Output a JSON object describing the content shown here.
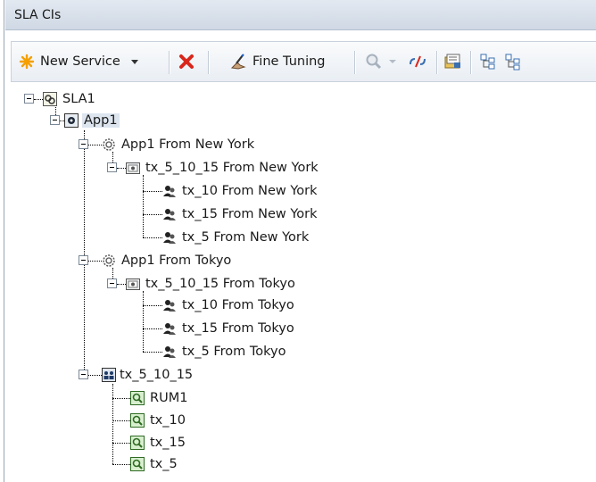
{
  "panel": {
    "title": "SLA CIs"
  },
  "toolbar": {
    "new_service_label": "New Service",
    "new_service_dropdown": "chevron-down",
    "fine_tuning_label": "Fine Tuning"
  },
  "tree": {
    "root": "SLA1",
    "app": "App1",
    "ny_group": "App1 From New York",
    "ny_tx": "tx_5_10_15 From New York",
    "ny_children": [
      "tx_10 From New York",
      "tx_15 From New York",
      "tx_5 From New York"
    ],
    "tokyo_group": "App1 From Tokyo",
    "tokyo_tx": "tx_5_10_15 From Tokyo",
    "tokyo_children": [
      "tx_10 From Tokyo",
      "tx_15 From Tokyo",
      "tx_5 From Tokyo"
    ],
    "tx_group": "tx_5_10_15",
    "tx_children": [
      "RUM1",
      "tx_10",
      "tx_15",
      "tx_5"
    ]
  },
  "icons": {
    "new_service": "asterisk-star-icon",
    "delete": "red-x-icon",
    "fine_tuning": "hand-pen-icon",
    "zoom": "magnifier-icon",
    "link": "link-icon",
    "properties": "properties-folder-icon",
    "expand_tree": "expand-tree-icon",
    "collapse_tree": "collapse-tree-icon"
  },
  "colors": {
    "title_bg": "#d7dfea",
    "selection": "#dde5ef",
    "delete_red": "#d9261c",
    "star_orange": "#f5a000",
    "rum_green": "#4ea33f"
  }
}
